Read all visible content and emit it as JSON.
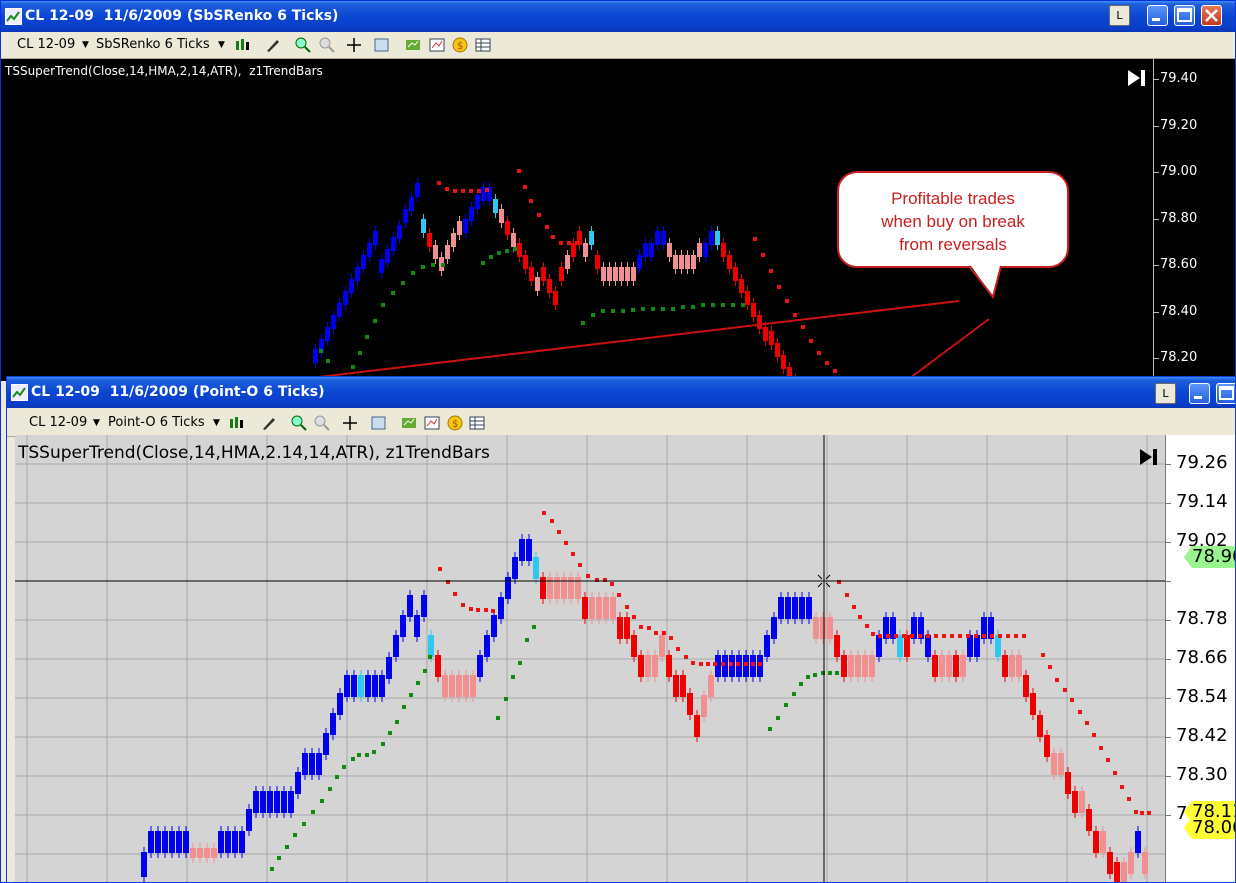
{
  "window_top": {
    "title": "CL 12-09  11/6/2009 (SbSRenko 6 Ticks)",
    "l_button": "L",
    "toolbar": {
      "symbol": "CL 12-09",
      "bar_type": "SbSRenko 6 Ticks"
    },
    "indicator_label": "TSSuperTrend(Close,14,HMA,2,14,ATR),  z1TrendBars",
    "y_ticks": [
      "79.40",
      "79.20",
      "79.00",
      "78.80",
      "78.60",
      "78.40",
      "78.20"
    ],
    "callout_lines": [
      "Profitable trades",
      "when buy on break",
      "from reversals"
    ]
  },
  "window_bottom": {
    "title": "CL 12-09  11/6/2009 (Point-O 6 Ticks)",
    "l_button": "L",
    "toolbar": {
      "symbol": "CL 12-09",
      "bar_type": "Point-O 6 Ticks"
    },
    "indicator_label": "TSSuperTrend(Close,14,HMA,2.14,14,ATR), z1TrendBars",
    "y_ticks": [
      "79.26",
      "79.14",
      "79.02",
      "78.90",
      "78.78",
      "78.66",
      "78.54",
      "78.42",
      "78.30",
      "78.18"
    ],
    "price_tags": [
      {
        "value": "78.90",
        "color": "#9af58f"
      },
      {
        "value": "78.11",
        "color": "#ffff33"
      },
      {
        "value": "78.06",
        "color": "#ffff33"
      }
    ]
  },
  "colors": {
    "up": "#0000ee",
    "up_light": "#2ec8f0",
    "down": "#ee0000",
    "down_light": "#f09090",
    "trend_up": "#108a10",
    "trend_down": "#ee1111",
    "trendline": "#cc1111"
  },
  "icons": [
    "chart-window-icon",
    "dropdown-arrow-icon",
    "candlestick-icon",
    "pencil-icon",
    "zoom-in-icon",
    "zoom-out-icon",
    "crosshair-icon",
    "data-box-icon",
    "strategy-icon",
    "chart-properties-icon",
    "money-icon",
    "grid-icon",
    "go-to-end-icon",
    "minimize-icon",
    "maximize-icon",
    "close-icon"
  ]
}
